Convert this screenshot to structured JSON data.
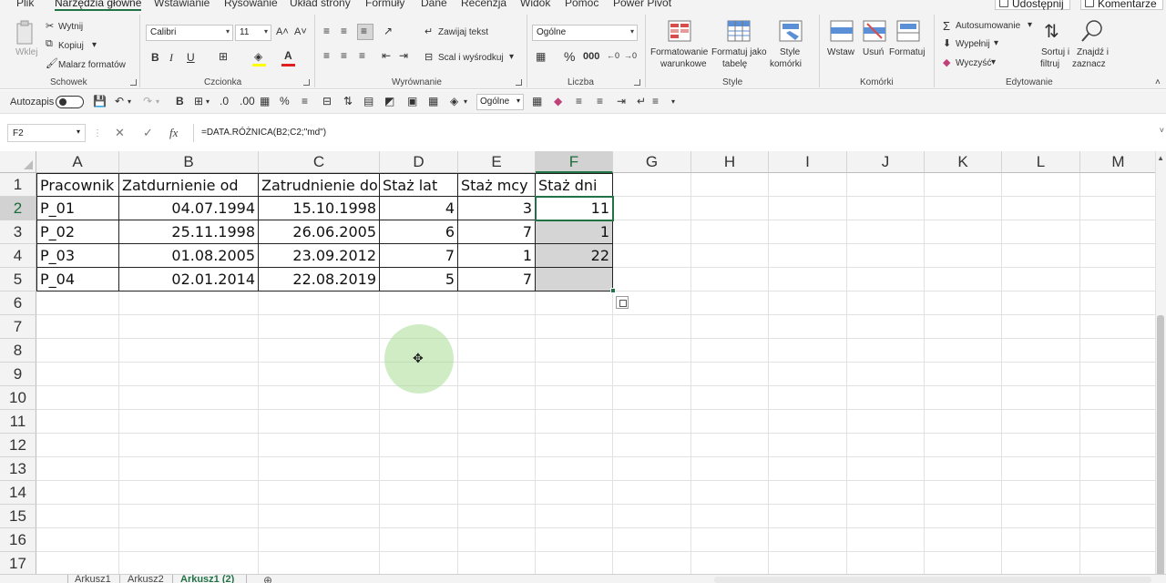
{
  "ribbon_tabs": [
    "Plik",
    "Narzędzia główne",
    "Wstawianie",
    "Rysowanie",
    "Układ strony",
    "Formuły",
    "Dane",
    "Recenzja",
    "Widok",
    "Pomoc",
    "Power Pivot"
  ],
  "active_tab": "Narzędzia główne",
  "share_label": "Udostępnij",
  "comments_label": "Komentarze",
  "clipboard": {
    "paste": "Wklej",
    "cut": "Wytnij",
    "copy": "Kopiuj",
    "format_painter": "Malarz formatów",
    "group": "Schowek"
  },
  "font": {
    "name": "Calibri",
    "size": "11",
    "group": "Czcionka"
  },
  "alignment": {
    "wrap": "Zawijaj tekst",
    "merge": "Scal i wyśrodkuj",
    "group": "Wyrównanie"
  },
  "number": {
    "format": "Ogólne",
    "group": "Liczba"
  },
  "styles": {
    "conditional": [
      "Formatowanie",
      "warunkowe"
    ],
    "format_table": [
      "Formatuj jako",
      "tabelę"
    ],
    "cell_styles": [
      "Style",
      "komórki"
    ],
    "group": "Style"
  },
  "cells": {
    "insert": "Wstaw",
    "delete": "Usuń",
    "format": "Formatuj",
    "group": "Komórki"
  },
  "editing": {
    "autosum": "Autosumowanie",
    "fill": "Wypełnij",
    "clear": "Wyczyść",
    "sort": [
      "Sortuj i",
      "filtruj"
    ],
    "find": [
      "Znajdź i",
      "zaznacz"
    ],
    "group": "Edytowanie"
  },
  "qat": {
    "autosave": "Autozapis",
    "numfmt": "Ogólne"
  },
  "formula_bar": {
    "name_box": "F2",
    "formula": "=DATA.RÓŻNICA(B2;C2;\"md\")"
  },
  "columns": [
    "A",
    "B",
    "C",
    "D",
    "E",
    "F",
    "G",
    "H",
    "I",
    "J",
    "K",
    "L",
    "M"
  ],
  "rows": [
    "1",
    "2",
    "3",
    "4",
    "5",
    "6",
    "7",
    "8",
    "9",
    "10",
    "11",
    "12",
    "13",
    "14",
    "15",
    "16",
    "17"
  ],
  "table": {
    "headers": [
      "Pracownik",
      "Zatdurnienie od",
      "Zatrudnienie do",
      "Staż lat",
      "Staż mcy",
      "Staż dni"
    ],
    "rows": [
      [
        "P_01",
        "04.07.1994",
        "15.10.1998",
        "4",
        "3",
        "11"
      ],
      [
        "P_02",
        "25.11.1998",
        "26.06.2005",
        "6",
        "7",
        "1"
      ],
      [
        "P_03",
        "01.08.2005",
        "23.09.2012",
        "7",
        "1",
        "22"
      ],
      [
        "P_04",
        "02.01.2014",
        "22.08.2019",
        "5",
        "7",
        ""
      ]
    ]
  },
  "sheets": [
    "Arkusz1",
    "Arkusz2",
    "Arkusz1 (2)"
  ],
  "active_sheet": "Arkusz1 (2)",
  "colors": {
    "accent": "#217346",
    "selected_fill": "#d5d5d5",
    "click_marker": "#aadc96"
  }
}
